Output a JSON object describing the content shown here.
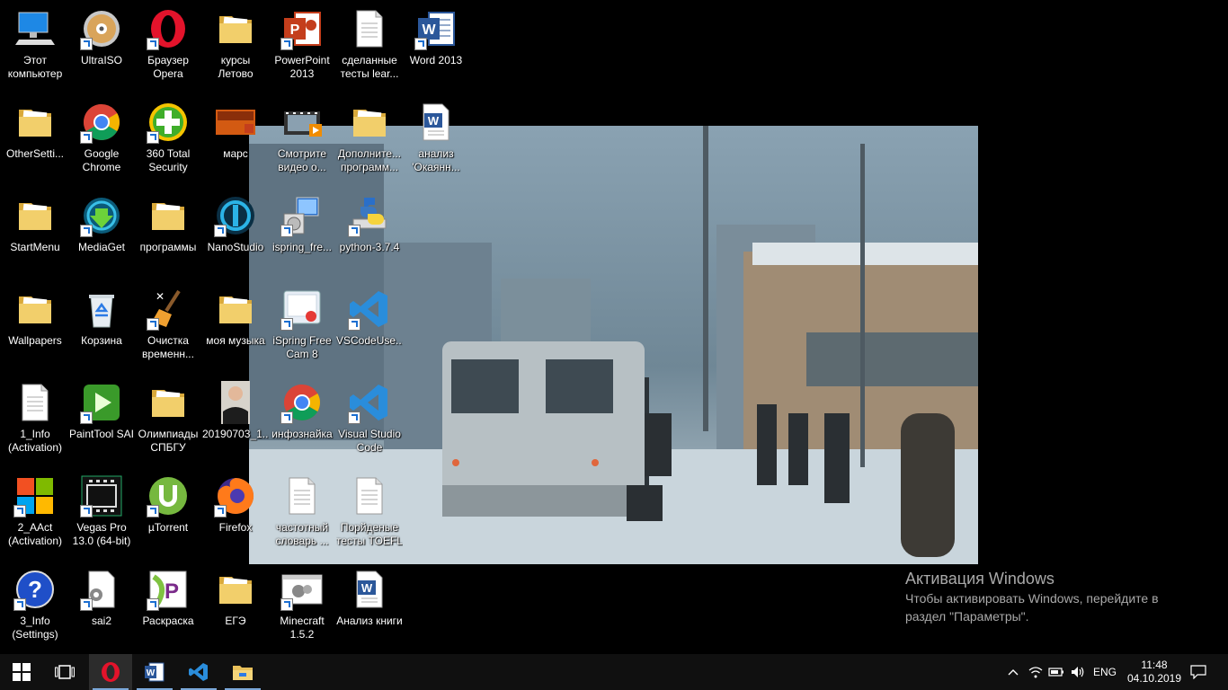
{
  "desktop": {
    "icons": [
      {
        "label": "Этот компьютер",
        "icon": "computer-icon"
      },
      {
        "label": "UltraISO",
        "icon": "disc-icon"
      },
      {
        "label": "Браузер Opera",
        "icon": "opera-icon"
      },
      {
        "label": "курсы Летово",
        "icon": "folder-icon"
      },
      {
        "label": "PowerPoint 2013",
        "icon": "powerpoint-icon"
      },
      {
        "label": "сделанные тесты lear...",
        "icon": "document-icon"
      },
      {
        "label": "Word 2013",
        "icon": "word-icon"
      },
      {
        "label": "OtherSetti...",
        "icon": "folder-icon"
      },
      {
        "label": "Google Chrome",
        "icon": "chrome-icon"
      },
      {
        "label": "360 Total Security",
        "icon": "security-plus-icon"
      },
      {
        "label": "марс",
        "icon": "presentation-icon"
      },
      {
        "label": "Смотрите видео о...",
        "icon": "video-icon"
      },
      {
        "label": "Дополните... программ...",
        "icon": "folder-icon"
      },
      {
        "label": "анализ 'Окаянн...",
        "icon": "word-doc-icon"
      },
      {
        "label": "StartMenu",
        "icon": "folder-icon"
      },
      {
        "label": "MediaGet",
        "icon": "mediaget-icon"
      },
      {
        "label": "программы",
        "icon": "folder-icon"
      },
      {
        "label": "NanoStudio",
        "icon": "nanostudio-icon"
      },
      {
        "label": "ispring_fre...",
        "icon": "installer-icon"
      },
      {
        "label": "python-3.7.4",
        "icon": "python-icon"
      },
      {
        "label": "Wallpapers",
        "icon": "folder-icon"
      },
      {
        "label": "Корзина",
        "icon": "recycle-bin-icon"
      },
      {
        "label": "Очистка временн...",
        "icon": "broom-icon"
      },
      {
        "label": "моя музыка",
        "icon": "folder-icon"
      },
      {
        "label": "iSpring Free Cam 8",
        "icon": "screen-record-icon"
      },
      {
        "label": "VSCodeUse...",
        "icon": "vscode-icon"
      },
      {
        "label": "1_Info (Activation)",
        "icon": "document-icon"
      },
      {
        "label": "PaintTool SAI",
        "icon": "play-icon"
      },
      {
        "label": "Олимпиады СПБГУ",
        "icon": "folder-icon"
      },
      {
        "label": "20190703_1...",
        "icon": "photo-icon"
      },
      {
        "label": "инфознайка",
        "icon": "chrome-icon"
      },
      {
        "label": "Visual Studio Code",
        "icon": "vscode-icon"
      },
      {
        "label": "2_AAct (Activation)",
        "icon": "windows-logo-icon"
      },
      {
        "label": "Vegas Pro 13.0 (64-bit)",
        "icon": "film-icon"
      },
      {
        "label": "µTorrent",
        "icon": "utorrent-icon"
      },
      {
        "label": "Firefox",
        "icon": "firefox-icon"
      },
      {
        "label": "частотный словарь ...",
        "icon": "document-icon"
      },
      {
        "label": "Порйденые тесты TOEFL",
        "icon": "document-icon"
      },
      {
        "label": "3_Info (Settings)",
        "icon": "help-icon"
      },
      {
        "label": "sai2",
        "icon": "settings-file-icon"
      },
      {
        "label": "Раскраска",
        "icon": "paint-icon"
      },
      {
        "label": "ЕГЭ",
        "icon": "folder-icon"
      },
      {
        "label": "Minecraft 1.5.2",
        "icon": "settings-window-icon"
      },
      {
        "label": "Анализ книги",
        "icon": "word-doc-icon"
      }
    ]
  },
  "activation": {
    "title": "Активация Windows",
    "text": "Чтобы активировать Windows, перейдите в раздел \"Параметры\"."
  },
  "taskbar": {
    "language": "ENG",
    "time": "11:48",
    "date": "04.10.2019"
  },
  "colors": {
    "taskbar": "#101010",
    "accent": "#7aa7d8",
    "folder": "#e8c05a",
    "word": "#2b579a"
  }
}
